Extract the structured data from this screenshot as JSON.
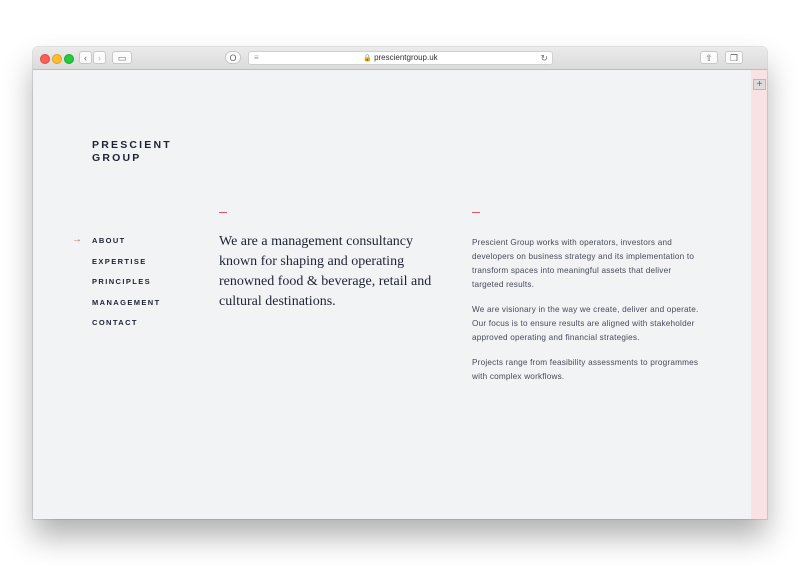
{
  "browser": {
    "url": "prescientgroup.uk",
    "reload_icon": "reload-icon",
    "lock_icon": "lock-icon"
  },
  "site": {
    "logo_line1": "PRESCIENT",
    "logo_line2": "GROUP",
    "nav": [
      {
        "label": "ABOUT",
        "active": true
      },
      {
        "label": "EXPERTISE"
      },
      {
        "label": "PRINCIPLES"
      },
      {
        "label": "MANAGEMENT"
      },
      {
        "label": "CONTACT"
      }
    ],
    "nav_arrow": "→",
    "headline": "We are a management consultancy known for shaping and operating renowned food & beverage, retail and cultural destinations.",
    "paragraphs": [
      "Prescient Group works with operators, investors and developers on business strategy and its implementation to transform spaces into meaningful assets that deliver targeted results.",
      "We are visionary in the way we create, deliver and operate. Our focus is to ensure results are aligned with stakeholder approved operating and financial strategies.",
      "Projects range from feasibility assessments to programmes with complex workflows."
    ]
  },
  "colors": {
    "accent": "#e0555f",
    "text": "#1d2333",
    "background": "#f2f3f5",
    "sidebar": "#f9e1e4"
  }
}
